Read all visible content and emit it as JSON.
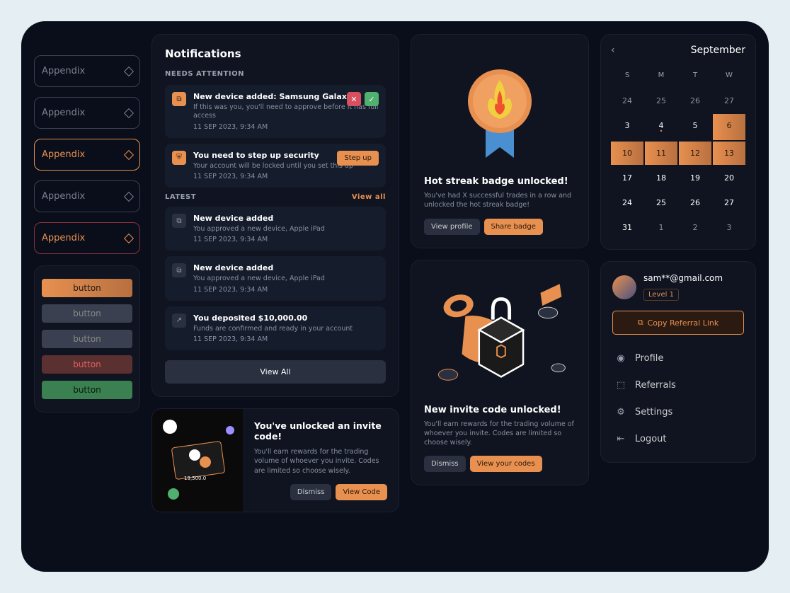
{
  "appendix": {
    "label": "Appendix",
    "buttons": [
      "button",
      "button",
      "button",
      "button",
      "button"
    ]
  },
  "notifications": {
    "title": "Notifications",
    "needs_attention_label": "NEEDS ATTENTION",
    "attention": [
      {
        "title": "New device added: Samsung Galaxy",
        "desc": "If this was you, you'll need to approve before it has full access",
        "date": "11 SEP 2023, 9:34 AM"
      },
      {
        "title": "You need to step up security",
        "desc": "Your account will be locked until you set this up",
        "date": "11 SEP 2023, 9:34 AM",
        "action": "Step up"
      }
    ],
    "latest_label": "LATEST",
    "view_all_link": "View all",
    "latest": [
      {
        "title": "New device added",
        "desc": "You approved a new device, Apple iPad",
        "date": "11 SEP 2023, 9:34 AM"
      },
      {
        "title": "New device added",
        "desc": "You approved a new device, Apple iPad",
        "date": "11 SEP 2023, 9:34 AM"
      },
      {
        "title": "You deposited $10,000.00",
        "desc": "Funds are confirmed and ready in your account",
        "date": "11 SEP 2023, 9:34 AM"
      }
    ],
    "view_all_button": "View All"
  },
  "invite1": {
    "title": "You've unlocked an invite code!",
    "desc": "You'll earn rewards for the trading volume of whoever you invite.  Codes are limited so choose wisely.",
    "dismiss": "Dismiss",
    "action": "View Code"
  },
  "hotstreak": {
    "title": "Hot streak badge unlocked!",
    "desc": "You've had X successful trades in a row and unlocked the hot streak badge!",
    "view": "View profile",
    "share": "Share badge"
  },
  "invite2": {
    "title": "New invite code unlocked!",
    "desc": "You'll earn rewards for the trading volume of whoever you invite. Codes are limited so choose wisely.",
    "dismiss": "Dismiss",
    "action": "View your codes"
  },
  "calendar": {
    "month": "September",
    "days": [
      "S",
      "M",
      "T",
      "W"
    ],
    "rows": [
      [
        "24",
        "25",
        "26",
        "27"
      ],
      [
        "3",
        "4",
        "5",
        "6"
      ],
      [
        "10",
        "11",
        "12",
        "13"
      ],
      [
        "17",
        "18",
        "19",
        "20"
      ],
      [
        "24",
        "25",
        "26",
        "27"
      ],
      [
        "31",
        "1",
        "2",
        "3"
      ]
    ]
  },
  "profile": {
    "email": "sam**@gmail.com",
    "level": "Level 1",
    "copy_referral": "Copy Referral Link",
    "menu": [
      "Profile",
      "Referrals",
      "Settings",
      "Logout"
    ]
  }
}
